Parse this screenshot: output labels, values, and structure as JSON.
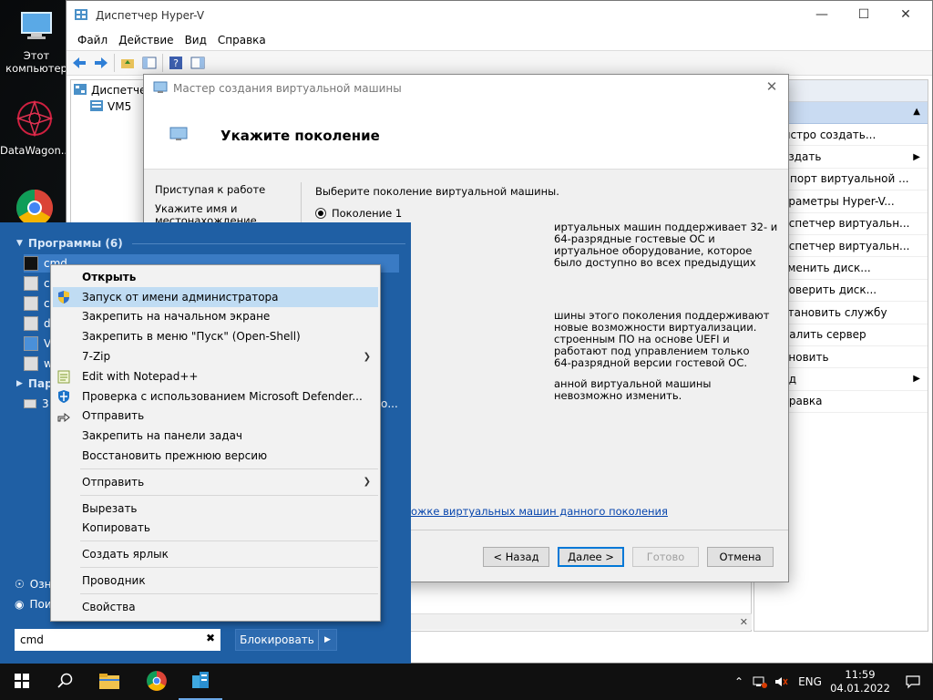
{
  "desktop": {
    "icons": [
      {
        "label": "Этот компьютер"
      },
      {
        "label": "DataWagon..."
      },
      {
        "label": "Google Chrome"
      }
    ]
  },
  "hyperv": {
    "title": "Диспетчер Hyper-V",
    "menu": [
      "Файл",
      "Действие",
      "Вид",
      "Справка"
    ],
    "tree": {
      "root": "Диспетчер",
      "child": "VM5"
    },
    "actions_header": "твия",
    "actions": [
      {
        "label": "ыстро создать...",
        "sub": false
      },
      {
        "label": "оздать",
        "sub": true
      },
      {
        "label": "мпорт виртуальной ...",
        "sub": false
      },
      {
        "label": "араметры Hyper-V...",
        "sub": false
      },
      {
        "label": "испетчер виртуальн...",
        "sub": false
      },
      {
        "label": "испетчер виртуальн...",
        "sub": false
      },
      {
        "label": "зменить диск...",
        "sub": false
      },
      {
        "label": "роверить диск...",
        "sub": false
      },
      {
        "label": "становить службу",
        "sub": false
      },
      {
        "label": "далить сервер",
        "sub": false
      },
      {
        "label": "бновить",
        "sub": false
      },
      {
        "label": "ид",
        "sub": true
      },
      {
        "label": "правка",
        "sub": false
      }
    ]
  },
  "wizard": {
    "title": "Мастер создания виртуальной машины",
    "heading": "Укажите поколение",
    "steps": [
      "Приступая к работе",
      "Укажите имя и местонахождение"
    ],
    "prompt": "Выберите поколение виртуальной машины.",
    "gen1": "Поколение 1",
    "p1a": "иртуальных машин поддерживает 32- и 64-разрядные гостевые ОС и",
    "p1b": "иртуальное оборудование, которое было доступно во всех предыдущих",
    "p2a": "шины этого поколения поддерживают новые возможности виртуализации.",
    "p2b": "строенным ПО на основе UEFI и работают под управлением только",
    "p2c": "64-разрядной версии гостевой ОС.",
    "p3": "анной виртуальной машины невозможно изменить.",
    "link": "ожке виртуальных машин данного поколения",
    "buttons": {
      "back": "< Назад",
      "next": "Далее >",
      "finish": "Готово",
      "cancel": "Отмена"
    }
  },
  "start": {
    "programs_header": "Программы (6)",
    "programs": [
      {
        "label": "cmd"
      },
      {
        "label": "c"
      },
      {
        "label": "c"
      },
      {
        "label": "d"
      },
      {
        "label": "V"
      },
      {
        "label": "w"
      }
    ],
    "params_header": "Пара",
    "params_item": "3",
    "params_tail": "о...",
    "bottom": [
      {
        "label": "Озн"
      },
      {
        "label": "Пои"
      }
    ],
    "search_value": "cmd",
    "lock_label": "Блокировать"
  },
  "context_menu": {
    "items": [
      {
        "label": "Открыть",
        "bold": true
      },
      {
        "label": "Запуск от имени администратора",
        "icon": "shield-icon",
        "highlighted": true
      },
      {
        "label": "Закрепить на начальном экране"
      },
      {
        "label": "Закрепить в меню \"Пуск\" (Open-Shell)"
      },
      {
        "label": "7-Zip",
        "sub": true
      },
      {
        "label": "Edit with Notepad++",
        "icon": "notepad-icon"
      },
      {
        "label": "Проверка с использованием Microsoft Defender...",
        "icon": "defender-icon"
      },
      {
        "label": "Отправить",
        "icon": "share-icon"
      },
      {
        "label": "Закрепить на панели задач"
      },
      {
        "label": "Восстановить прежнюю версию"
      },
      {
        "label": "Отправить",
        "sub": true
      },
      {
        "label": "Вырезать"
      },
      {
        "label": "Копировать"
      },
      {
        "label": "Создать ярлык"
      },
      {
        "label": "Проводник"
      },
      {
        "label": "Свойства"
      }
    ]
  },
  "taskbar": {
    "lang": "ENG",
    "time": "11:59",
    "date": "04.01.2022"
  }
}
